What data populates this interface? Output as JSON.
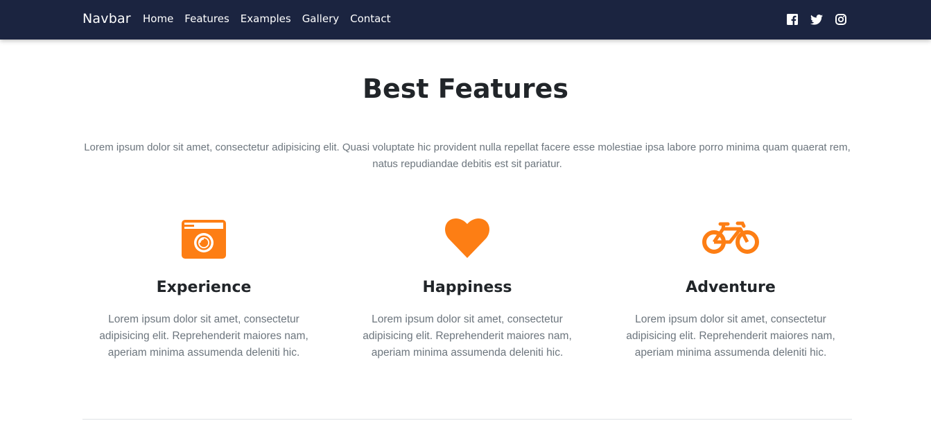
{
  "navbar": {
    "brand": "Navbar",
    "links": [
      "Home",
      "Features",
      "Examples",
      "Gallery",
      "Contact"
    ],
    "social_icons": [
      "facebook-icon",
      "twitter-icon",
      "instagram-icon"
    ]
  },
  "section": {
    "title": "Best Features",
    "intro": "Lorem ipsum dolor sit amet, consectetur adipisicing elit. Quasi voluptate hic provident nulla repellat facere esse molestiae ipsa labore porro minima quam quaerat rem, natus repudiandae debitis est sit pariatur."
  },
  "features": [
    {
      "icon": "camera-icon",
      "title": "Experience",
      "text": "Lorem ipsum dolor sit amet, consectetur adipisicing elit. Reprehenderit maiores nam, aperiam minima assumenda deleniti hic."
    },
    {
      "icon": "heart-icon",
      "title": "Happiness",
      "text": "Lorem ipsum dolor sit amet, consectetur adipisicing elit. Reprehenderit maiores nam, aperiam minima assumenda deleniti hic."
    },
    {
      "icon": "bicycle-icon",
      "title": "Adventure",
      "text": "Lorem ipsum dolor sit amet, consectetur adipisicing elit. Reprehenderit maiores nam, aperiam minima assumenda deleniti hic."
    }
  ],
  "colors": {
    "navbar_bg": "#1b2440",
    "accent": "#fd7e14",
    "muted_text": "#6c757d"
  }
}
